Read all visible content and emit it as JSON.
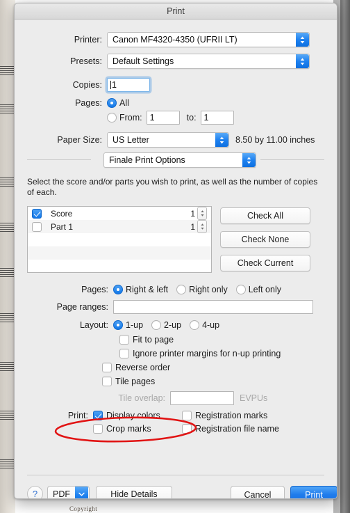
{
  "background": {
    "copyright_text": "Copyright"
  },
  "dialog": {
    "title": "Print",
    "printer": {
      "label": "Printer:",
      "value": "Canon MF4320-4350 (UFRII LT)",
      "arrows_icon": "up-down-chevron-icon"
    },
    "presets": {
      "label": "Presets:",
      "value": "Default Settings",
      "arrows_icon": "up-down-chevron-icon"
    },
    "copies": {
      "label": "Copies:",
      "value": "1"
    },
    "pages": {
      "label": "Pages:",
      "all_label": "All",
      "all_selected": true,
      "range_selected": false,
      "from_label": "From:",
      "from_value": "1",
      "to_label": "to:",
      "to_value": "1"
    },
    "paper_size": {
      "label": "Paper Size:",
      "value": "US Letter",
      "dimensions": "8.50 by 11.00 inches",
      "arrows_icon": "up-down-chevron-icon"
    },
    "pane": {
      "popup_value": "Finale Print Options",
      "arrows_icon": "up-down-chevron-icon",
      "description": "Select the score and/or parts you wish to print, as well as the number of copies of each."
    },
    "parts_list": {
      "items": [
        {
          "name": "Score",
          "checked": true,
          "copies": "1"
        },
        {
          "name": "Part 1",
          "checked": false,
          "copies": "1"
        }
      ],
      "buttons": [
        "Check All",
        "Check None",
        "Check Current"
      ]
    },
    "page_sides": {
      "label": "Pages:",
      "options": [
        {
          "label": "Right & left",
          "selected": true
        },
        {
          "label": "Right only",
          "selected": false
        },
        {
          "label": "Left only",
          "selected": false
        }
      ]
    },
    "page_ranges": {
      "label": "Page ranges:",
      "value": ""
    },
    "layout": {
      "label": "Layout:",
      "options": [
        {
          "label": "1-up",
          "selected": true
        },
        {
          "label": "2-up",
          "selected": false
        },
        {
          "label": "4-up",
          "selected": false
        }
      ]
    },
    "checkboxes": [
      {
        "label": "Fit to page",
        "checked": false,
        "indent": 2
      },
      {
        "label": "Ignore printer margins for n-up printing",
        "checked": false,
        "indent": 2
      },
      {
        "label": "Reverse order",
        "checked": false,
        "indent": 1
      },
      {
        "label": "Tile pages",
        "checked": false,
        "indent": 1
      }
    ],
    "tile_overlap": {
      "label": "Tile overlap:",
      "value": "",
      "units": "EVPUs",
      "enabled": false
    },
    "print_options": {
      "label": "Print:",
      "items": [
        {
          "label": "Display colors",
          "checked": true
        },
        {
          "label": "Registration marks",
          "checked": false
        },
        {
          "label": "Crop marks",
          "checked": false
        },
        {
          "label": "Registration file name",
          "checked": false
        }
      ]
    },
    "footer": {
      "help_label": "?",
      "pdf_label": "PDF",
      "pdf_chevron_icon": "chevron-down-icon",
      "hide_details_label": "Hide Details",
      "cancel_label": "Cancel",
      "print_label": "Print"
    }
  },
  "annotation": {
    "shape": "ellipse",
    "color": "#e11414",
    "target": "Print: Display colors"
  },
  "colors": {
    "accent_blue": "#1f7cec",
    "dialog_bg": "#ececec",
    "annotation_red": "#e11414"
  }
}
